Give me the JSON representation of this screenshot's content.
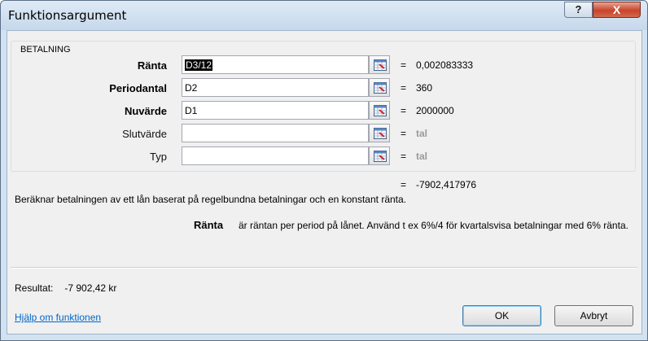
{
  "window": {
    "title": "Funktionsargument",
    "help_button": "?",
    "close_button": "X"
  },
  "function": {
    "name": "BETALNING",
    "arguments": [
      {
        "label": "Ränta",
        "value": "D3/12",
        "result": "0,002083333",
        "bold": true,
        "selected": true
      },
      {
        "label": "Periodantal",
        "value": "D2",
        "result": "360",
        "bold": true,
        "selected": false
      },
      {
        "label": "Nuvärde",
        "value": "D1",
        "result": "2000000",
        "bold": true,
        "selected": false
      },
      {
        "label": "Slutvärde",
        "value": "",
        "result": "tal",
        "bold": false,
        "selected": false
      },
      {
        "label": "Typ",
        "value": "",
        "result": "tal",
        "bold": false,
        "selected": false
      }
    ],
    "equals": "=",
    "formula_result": "-7902,417976",
    "description": "Beräknar betalningen av ett lån baserat på regelbundna betalningar och en konstant ränta.",
    "help_arg_name": "Ränta",
    "help_arg_text": "är räntan per period på lånet. Använd t ex 6%/4 för kvartalsvisa betalningar med 6% ränta."
  },
  "result": {
    "label": "Resultat:",
    "value": "-7 902,42 kr"
  },
  "footer": {
    "help_link": "Hjälp om funktionen",
    "ok_label": "OK",
    "cancel_label": "Avbryt"
  }
}
